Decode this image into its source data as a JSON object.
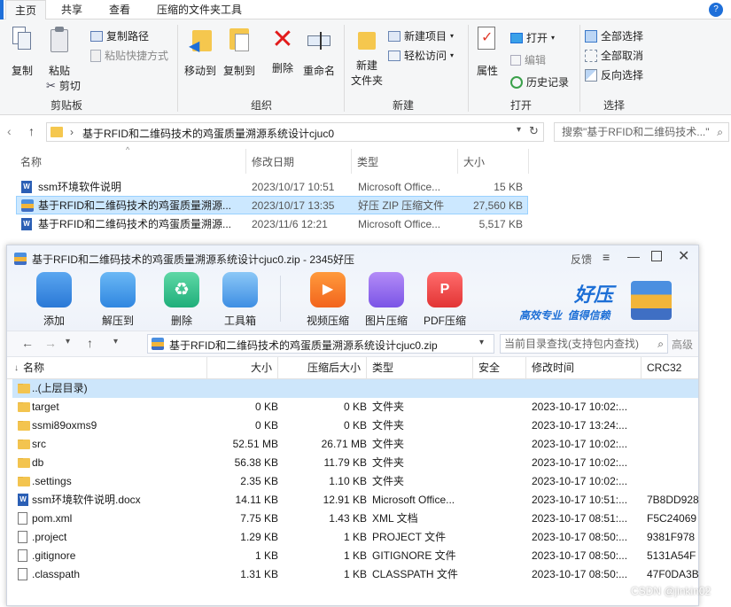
{
  "ribbon_tabs": [
    "主页",
    "共享",
    "查看",
    "压缩的文件夹工具"
  ],
  "ribbon": {
    "copy": "复制",
    "paste": "粘贴",
    "copy_path": "复制路径",
    "paste_shortcut": "粘贴快捷方式",
    "cut": "剪切",
    "group_clipboard": "剪贴板",
    "move_to": "移动到",
    "copy_to": "复制到",
    "delete": "删除",
    "rename": "重命名",
    "group_organize": "组织",
    "new_folder_line1": "新建",
    "new_folder_line2": "文件夹",
    "new_item": "新建项目",
    "easy_access": "轻松访问",
    "group_new": "新建",
    "properties": "属性",
    "open": "打开",
    "edit": "编辑",
    "history": "历史记录",
    "group_open": "打开",
    "select_all": "全部选择",
    "select_none": "全部取消",
    "invert_selection": "反向选择",
    "group_select": "选择"
  },
  "address_bar": {
    "path": "基于RFID和二维码技术的鸡蛋质量溯源系统设计cjuc0",
    "search_placeholder": "搜索\"基于RFID和二维码技术...\""
  },
  "explorer_columns": [
    "名称",
    "修改日期",
    "类型",
    "大小"
  ],
  "explorer_files": [
    {
      "name": "ssm环境软件说明",
      "date": "2023/10/17 10:51",
      "type": "Microsoft Office...",
      "size": "15 KB"
    },
    {
      "name": "基于RFID和二维码技术的鸡蛋质量溯源...",
      "date": "2023/10/17 13:35",
      "type": "好压 ZIP 压缩文件",
      "size": "27,560 KB"
    },
    {
      "name": "基于RFID和二维码技术的鸡蛋质量溯源...",
      "date": "2023/11/6 12:21",
      "type": "Microsoft Office...",
      "size": "5,517 KB"
    }
  ],
  "haozip": {
    "title": "基于RFID和二维码技术的鸡蛋质量溯源系统设计cjuc0.zip - 2345好压",
    "feedback": "反馈",
    "toolbar": [
      "添加",
      "解压到",
      "删除",
      "工具箱",
      "视频压缩",
      "图片压缩",
      "PDF压缩"
    ],
    "brand_name": "好压",
    "brand_slogan": "高效专业  值得信赖",
    "path": "基于RFID和二维码技术的鸡蛋质量溯源系统设计cjuc0.zip",
    "search_placeholder": "当前目录查找(支持包内查找)",
    "advanced": "高级",
    "columns": [
      "名称",
      "大小",
      "压缩后大小",
      "类型",
      "安全",
      "修改时间",
      "CRC32"
    ],
    "rows": [
      {
        "name": "..(上层目录)",
        "size": "",
        "packed": "",
        "type": "",
        "time": "",
        "crc": "",
        "kind": "folder"
      },
      {
        "name": "target",
        "size": "0 KB",
        "packed": "0 KB",
        "type": "文件夹",
        "time": "2023-10-17 10:02:...",
        "crc": "",
        "kind": "folder"
      },
      {
        "name": "ssmi89oxms9",
        "size": "0 KB",
        "packed": "0 KB",
        "type": "文件夹",
        "time": "2023-10-17 13:24:...",
        "crc": "",
        "kind": "folder"
      },
      {
        "name": "src",
        "size": "52.51 MB",
        "packed": "26.71 MB",
        "type": "文件夹",
        "time": "2023-10-17 10:02:...",
        "crc": "",
        "kind": "folder"
      },
      {
        "name": "db",
        "size": "56.38 KB",
        "packed": "11.79 KB",
        "type": "文件夹",
        "time": "2023-10-17 10:02:...",
        "crc": "",
        "kind": "folder"
      },
      {
        "name": ".settings",
        "size": "2.35 KB",
        "packed": "1.10 KB",
        "type": "文件夹",
        "time": "2023-10-17 10:02:...",
        "crc": "",
        "kind": "folder"
      },
      {
        "name": "ssm环境软件说明.docx",
        "size": "14.11 KB",
        "packed": "12.91 KB",
        "type": "Microsoft Office...",
        "time": "2023-10-17 10:51:...",
        "crc": "7B8DD928",
        "kind": "word"
      },
      {
        "name": "pom.xml",
        "size": "7.75 KB",
        "packed": "1.43 KB",
        "type": "XML 文档",
        "time": "2023-10-17 08:51:...",
        "crc": "F5C24069",
        "kind": "file"
      },
      {
        "name": ".project",
        "size": "1.29 KB",
        "packed": "1 KB",
        "type": "PROJECT 文件",
        "time": "2023-10-17 08:50:...",
        "crc": "9381F978",
        "kind": "file"
      },
      {
        "name": ".gitignore",
        "size": "1 KB",
        "packed": "1 KB",
        "type": "GITIGNORE 文件",
        "time": "2023-10-17 08:50:...",
        "crc": "5131A54F",
        "kind": "file"
      },
      {
        "name": ".classpath",
        "size": "1.31 KB",
        "packed": "1 KB",
        "type": "CLASSPATH 文件",
        "time": "2023-10-17 08:50:...",
        "crc": "47F0DA3B",
        "kind": "file"
      }
    ]
  },
  "watermark": "CSDN @jinkin02"
}
